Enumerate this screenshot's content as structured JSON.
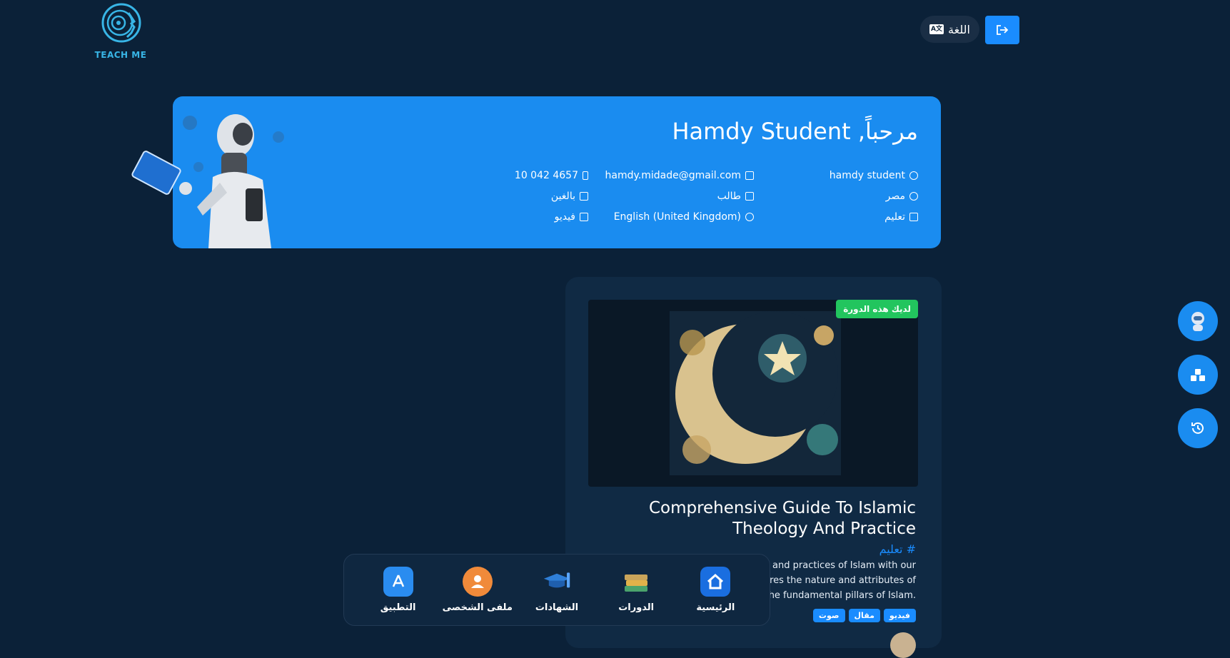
{
  "header": {
    "logo_text": "TEACH ME",
    "language_label": "اللغة",
    "language_icon_text": "A文"
  },
  "welcome": {
    "title": "مرحباً, Hamdy Student",
    "info": {
      "username": "hamdy student",
      "email": "hamdy.midade@gmail.com",
      "phone": "10 042 4657",
      "country": "مصر",
      "role": "طالب",
      "age_group": "بالغين",
      "category": "تعليم",
      "language": "English (United Kingdom)",
      "content_type": "فيديو"
    }
  },
  "course": {
    "badge": "لديك هذه الدورة",
    "title": "Comprehensive Guide To Islamic Theology And Practice",
    "tag": "# تعليم",
    "description_lines": [
      "iefs and practices of Islam with our",
      "plores the nature and attributes of",
      "nd the fundamental pillars of Islam."
    ],
    "chips": [
      "فيديو",
      "مقال",
      "صوت"
    ]
  },
  "bottom_nav": {
    "items": [
      {
        "label": "الرئيسية",
        "icon": "home-icon"
      },
      {
        "label": "الدورات",
        "icon": "books-icon"
      },
      {
        "label": "الشهادات",
        "icon": "graduation-cap-icon"
      },
      {
        "label": "ملفى الشخصى",
        "icon": "profile-icon"
      },
      {
        "label": "التطبيق",
        "icon": "app-store-icon"
      }
    ]
  },
  "side_buttons": [
    {
      "icon": "robot-assistant-icon"
    },
    {
      "icon": "blocks-icon"
    },
    {
      "icon": "history-icon"
    }
  ],
  "colors": {
    "background": "#0b2138",
    "primary": "#1a8cf0",
    "success": "#22c55e",
    "card": "#102a44"
  }
}
